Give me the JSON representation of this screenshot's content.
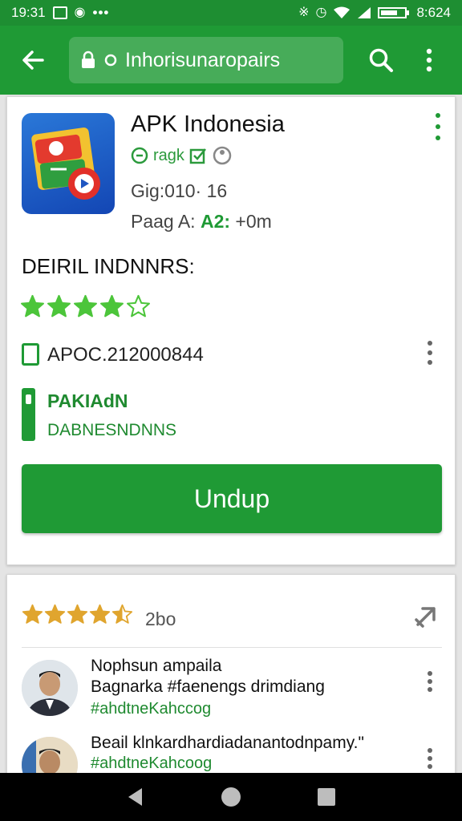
{
  "status_bar": {
    "time": "19:31",
    "right_text": "8:624",
    "icons": [
      "mail-icon",
      "gallery-icon",
      "bluetooth-icon",
      "alarm-icon",
      "wifi-icon",
      "signal-icon",
      "battery-icon"
    ]
  },
  "app_bar": {
    "url_text": "Inhorisunaropairs"
  },
  "app": {
    "name": "APK Indonesia",
    "verified_label": "ragk",
    "meta_line1": "Gig:010· 16",
    "meta_line2_prefix": "Paag A:",
    "meta_line2_highlight": "A2:",
    "meta_line2_suffix": "+0m",
    "section_title": "DEIRIL INDNNRS:",
    "rating": 4,
    "rating_max": 5,
    "code": "APOC.212000844",
    "package_title": "PAKIAdN",
    "package_sub": "DABNESNDNNS",
    "download_label": "Undup"
  },
  "reviews": {
    "rating": 4.5,
    "rating_max": 5,
    "count": "2bo",
    "items": [
      {
        "line1": "Nophsun ampaila",
        "line2": "Bagnarka #faenengs drimdiang",
        "tag": "#ahdtneKahccog"
      },
      {
        "line1": "Beail klnkardhardiadanantodnpamy.\"",
        "line2": "",
        "tag": "#ahdtneKahcoog"
      }
    ]
  },
  "colors": {
    "primary_green": "#1f9a35",
    "status_green": "#1e8e32",
    "star_green": "#4cc53a",
    "star_gold": "#e0a52e"
  }
}
